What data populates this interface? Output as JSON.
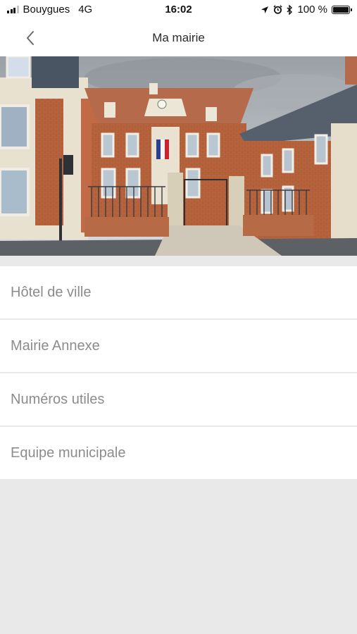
{
  "status_bar": {
    "carrier": "Bouygues",
    "network": "4G",
    "time": "16:02",
    "battery_text": "100 %"
  },
  "nav": {
    "title": "Ma mairie",
    "back_icon": "chevron-left-icon"
  },
  "menu": {
    "items": [
      {
        "label": "Hôtel de ville"
      },
      {
        "label": "Mairie Annexe"
      },
      {
        "label": "Numéros utiles"
      },
      {
        "label": "Equipe municipale"
      }
    ]
  },
  "colors": {
    "background": "#e9e9e9",
    "list_text": "#8c8c8c",
    "title_text": "#2a2a2a"
  }
}
